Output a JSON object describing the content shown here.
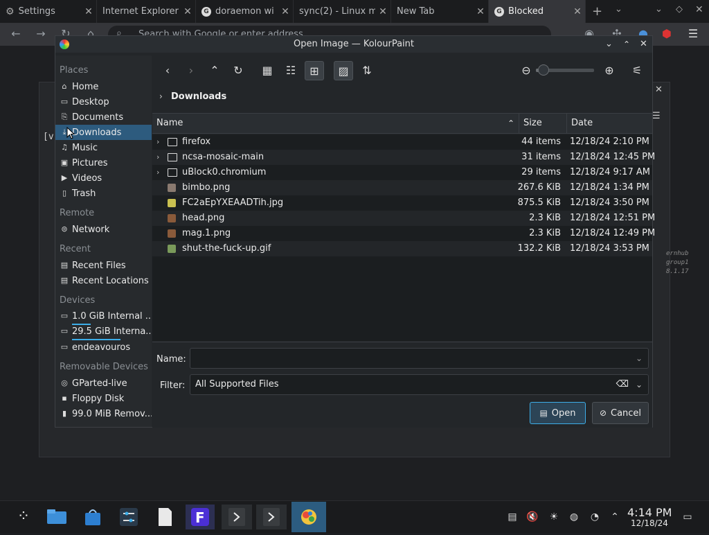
{
  "browser": {
    "tabs": [
      {
        "label": "Settings",
        "icon": "gear-icon"
      },
      {
        "label": "Internet Explorer",
        "icon": "blank-icon"
      },
      {
        "label": "doraemon wi",
        "icon": "google-icon"
      },
      {
        "label": "sync(2) - Linux m",
        "icon": "blank-icon"
      },
      {
        "label": "New Tab",
        "icon": "blank-icon"
      },
      {
        "label": "Blocked",
        "icon": "google-icon"
      }
    ],
    "omnibox_placeholder": "Search with Google or enter address"
  },
  "background": {
    "left_fragment": "[v",
    "right_lines": [
      "ernhub",
      "group1",
      "8.1.17"
    ]
  },
  "dialog": {
    "title": "Open Image — KolourPaint",
    "places": {
      "headers": {
        "places": "Places",
        "remote": "Remote",
        "recent": "Recent",
        "devices": "Devices",
        "removable": "Removable Devices"
      },
      "places_items": [
        {
          "label": "Home",
          "icon": "home-icon"
        },
        {
          "label": "Desktop",
          "icon": "desktop-icon"
        },
        {
          "label": "Documents",
          "icon": "documents-icon"
        },
        {
          "label": "Downloads",
          "icon": "download-icon",
          "selected": true
        },
        {
          "label": "Music",
          "icon": "music-icon"
        },
        {
          "label": "Pictures",
          "icon": "pictures-icon"
        },
        {
          "label": "Videos",
          "icon": "videos-icon"
        },
        {
          "label": "Trash",
          "icon": "trash-icon"
        }
      ],
      "remote_items": [
        {
          "label": "Network",
          "icon": "network-icon"
        }
      ],
      "recent_items": [
        {
          "label": "Recent Files",
          "icon": "recent-files-icon"
        },
        {
          "label": "Recent Locations",
          "icon": "recent-locations-icon"
        }
      ],
      "device_items": [
        {
          "label": "1.0 GiB Internal ...",
          "icon": "drive-icon",
          "usage": 0.25
        },
        {
          "label": "29.5 GiB Interna...",
          "icon": "drive-icon",
          "usage": 0.65
        },
        {
          "label": "endeavouros",
          "icon": "drive-icon"
        }
      ],
      "removable_items": [
        {
          "label": "GParted-live",
          "icon": "disc-icon"
        },
        {
          "label": "Floppy Disk",
          "icon": "floppy-icon"
        },
        {
          "label": "99.0 MiB Remov...",
          "icon": "usb-icon"
        }
      ]
    },
    "breadcrumb": "Downloads",
    "columns": {
      "name": "Name",
      "size": "Size",
      "date": "Date"
    },
    "files": [
      {
        "name": "firefox",
        "size": "44 items",
        "date": "12/18/24 2:10 PM",
        "type": "folder"
      },
      {
        "name": "ncsa-mosaic-main",
        "size": "31 items",
        "date": "12/18/24 12:45 PM",
        "type": "folder"
      },
      {
        "name": "uBlock0.chromium",
        "size": "29 items",
        "date": "12/18/24 9:17 AM",
        "type": "folder"
      },
      {
        "name": "bimbo.png",
        "size": "267.6 KiB",
        "date": "12/18/24 1:34 PM",
        "type": "image"
      },
      {
        "name": "FC2aEpYXEAADTih.jpg",
        "size": "875.5 KiB",
        "date": "12/18/24 3:50 PM",
        "type": "image"
      },
      {
        "name": "head.png",
        "size": "2.3 KiB",
        "date": "12/18/24 12:51 PM",
        "type": "image"
      },
      {
        "name": "mag.1.png",
        "size": "2.3 KiB",
        "date": "12/18/24 12:49 PM",
        "type": "image"
      },
      {
        "name": "shut-the-fuck-up.gif",
        "size": "132.2 KiB",
        "date": "12/18/24 3:53 PM",
        "type": "image"
      }
    ],
    "name_label": "Name:",
    "name_value": "",
    "filter_label": "Filter:",
    "filter_value": "All Supported Files",
    "open_label": "Open",
    "cancel_label": "Cancel",
    "zoom_level": 0.05
  },
  "taskbar": {
    "time": "4:14 PM",
    "date": "12/18/24"
  },
  "colors": {
    "accent": "#3daee9",
    "selection": "#2d5b7e"
  }
}
